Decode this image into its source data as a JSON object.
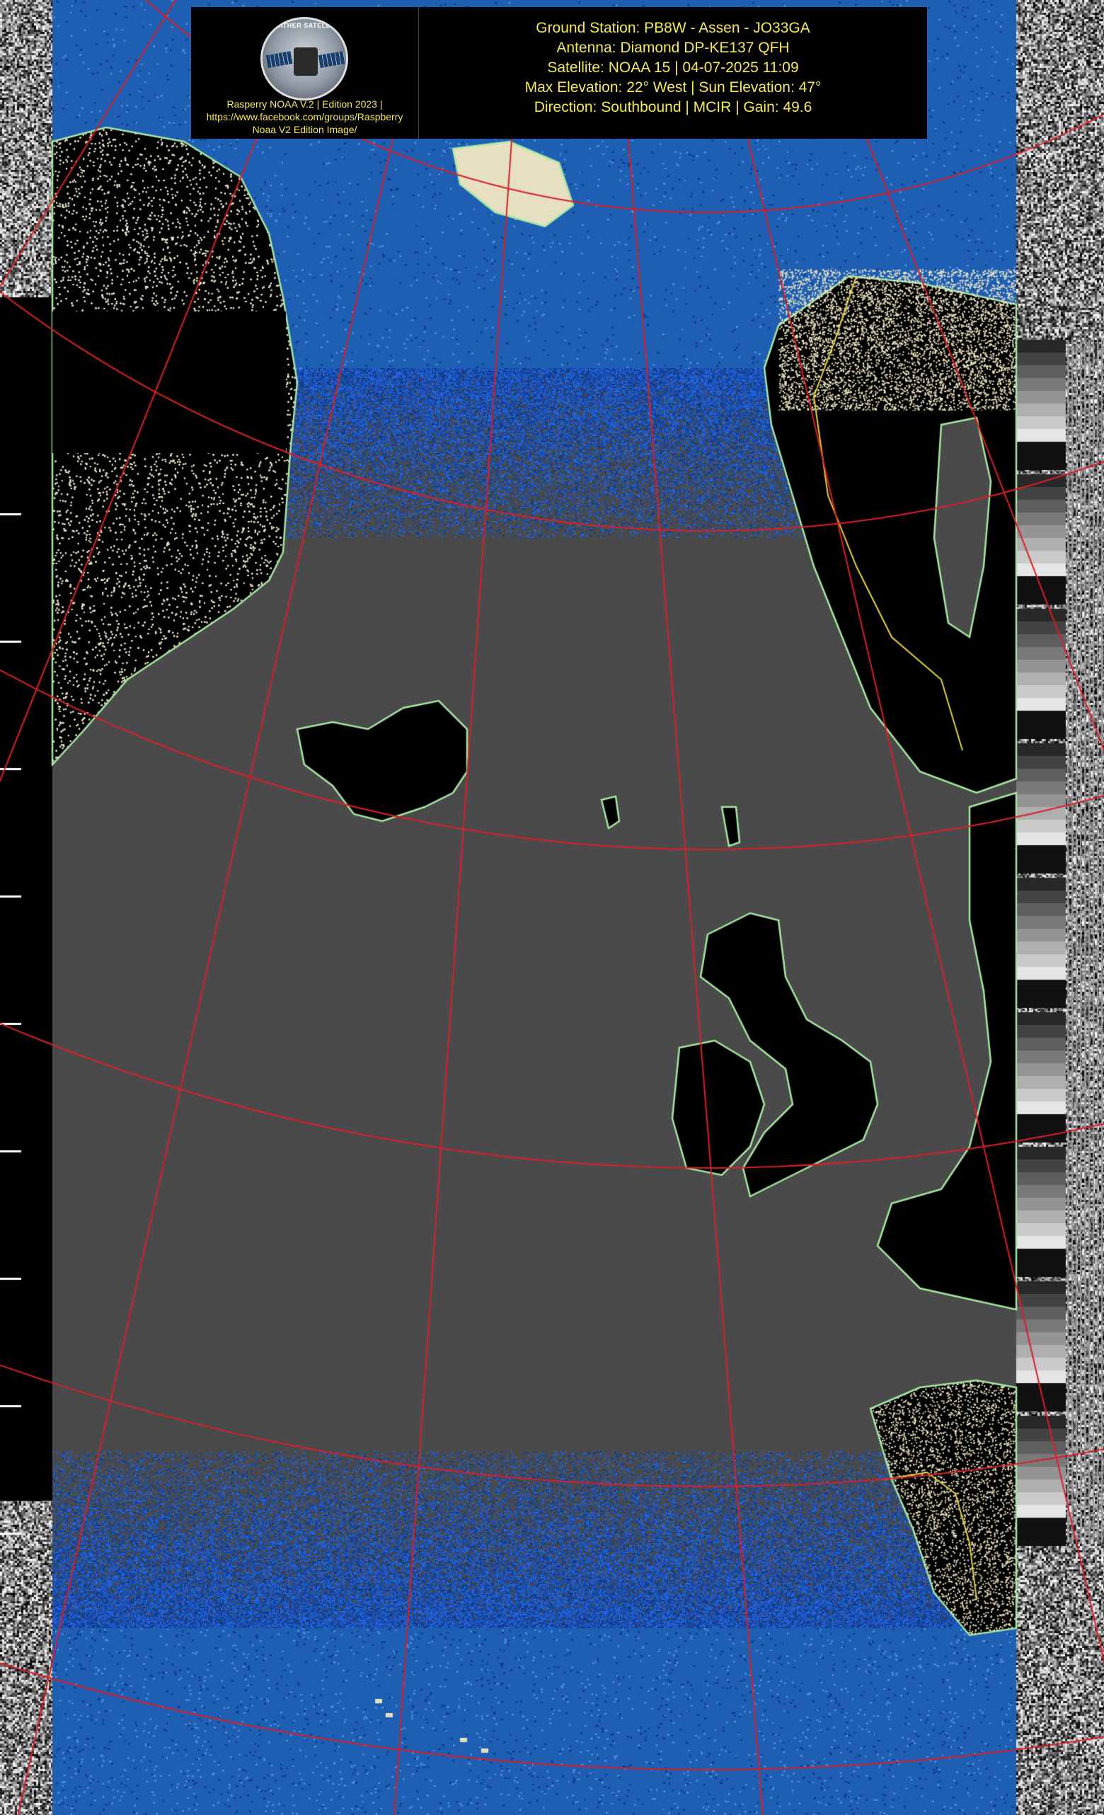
{
  "logo": {
    "ring_text": "WEATHER SATELLITE",
    "caption_1": "Rasperry NOAA V.2 | Edition 2023 |",
    "caption_2": "https://www.facebook.com/groups/Raspberry",
    "caption_3": "Noaa V2 Edition Image/"
  },
  "info": {
    "ground_station": "Ground Station: PB8W - Assen - JO33GA",
    "antenna": "Antenna: Diamond DP-KE137 QFH",
    "satellite": "Satellite: NOAA 15 | 04-07-2025 11:09",
    "elevation": "Max Elevation: 22° West | Sun Elevation: 47°",
    "direction": "Direction: Southbound | MCIR | Gain: 49.6"
  },
  "colors": {
    "sea": "#4a4a4a",
    "noise_sea": "#1d5fb5",
    "land": "#000000",
    "coastline": "#a8e6a3",
    "graticule": "#d8202a",
    "border": "#e6d23a",
    "text": "#f5e85a"
  }
}
